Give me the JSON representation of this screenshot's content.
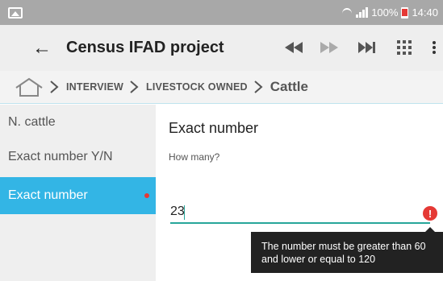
{
  "status_bar": {
    "battery": "100%",
    "time": "14:40"
  },
  "toolbar": {
    "back_icon": "arrow-left-icon",
    "title": "Census IFAD project",
    "icons": [
      "rewind-icon",
      "fast-forward-icon",
      "skip-to-end-icon",
      "grid-icon",
      "more-vert-icon"
    ]
  },
  "breadcrumb": {
    "home_icon": "home-icon",
    "items": [
      "INTERVIEW",
      "LIVESTOCK OWNED"
    ],
    "current": "Cattle"
  },
  "sidebar": {
    "items": [
      {
        "label": "N. cattle",
        "active": false,
        "error": false
      },
      {
        "label": "Exact number Y/N",
        "active": false,
        "error": false
      },
      {
        "label": "Exact number",
        "active": true,
        "error": true
      }
    ]
  },
  "question": {
    "title": "Exact number",
    "hint": "How many?",
    "answer_value": "23",
    "error_message": "The number must be greater than 60 and lower or equal to 120"
  },
  "colors": {
    "status_bar": "#a8a8a8",
    "toolbar": "#eeeeee",
    "accent": "#33b5e5",
    "input_line": "#26a69a",
    "error": "#e53935",
    "tooltip": "#222222"
  }
}
